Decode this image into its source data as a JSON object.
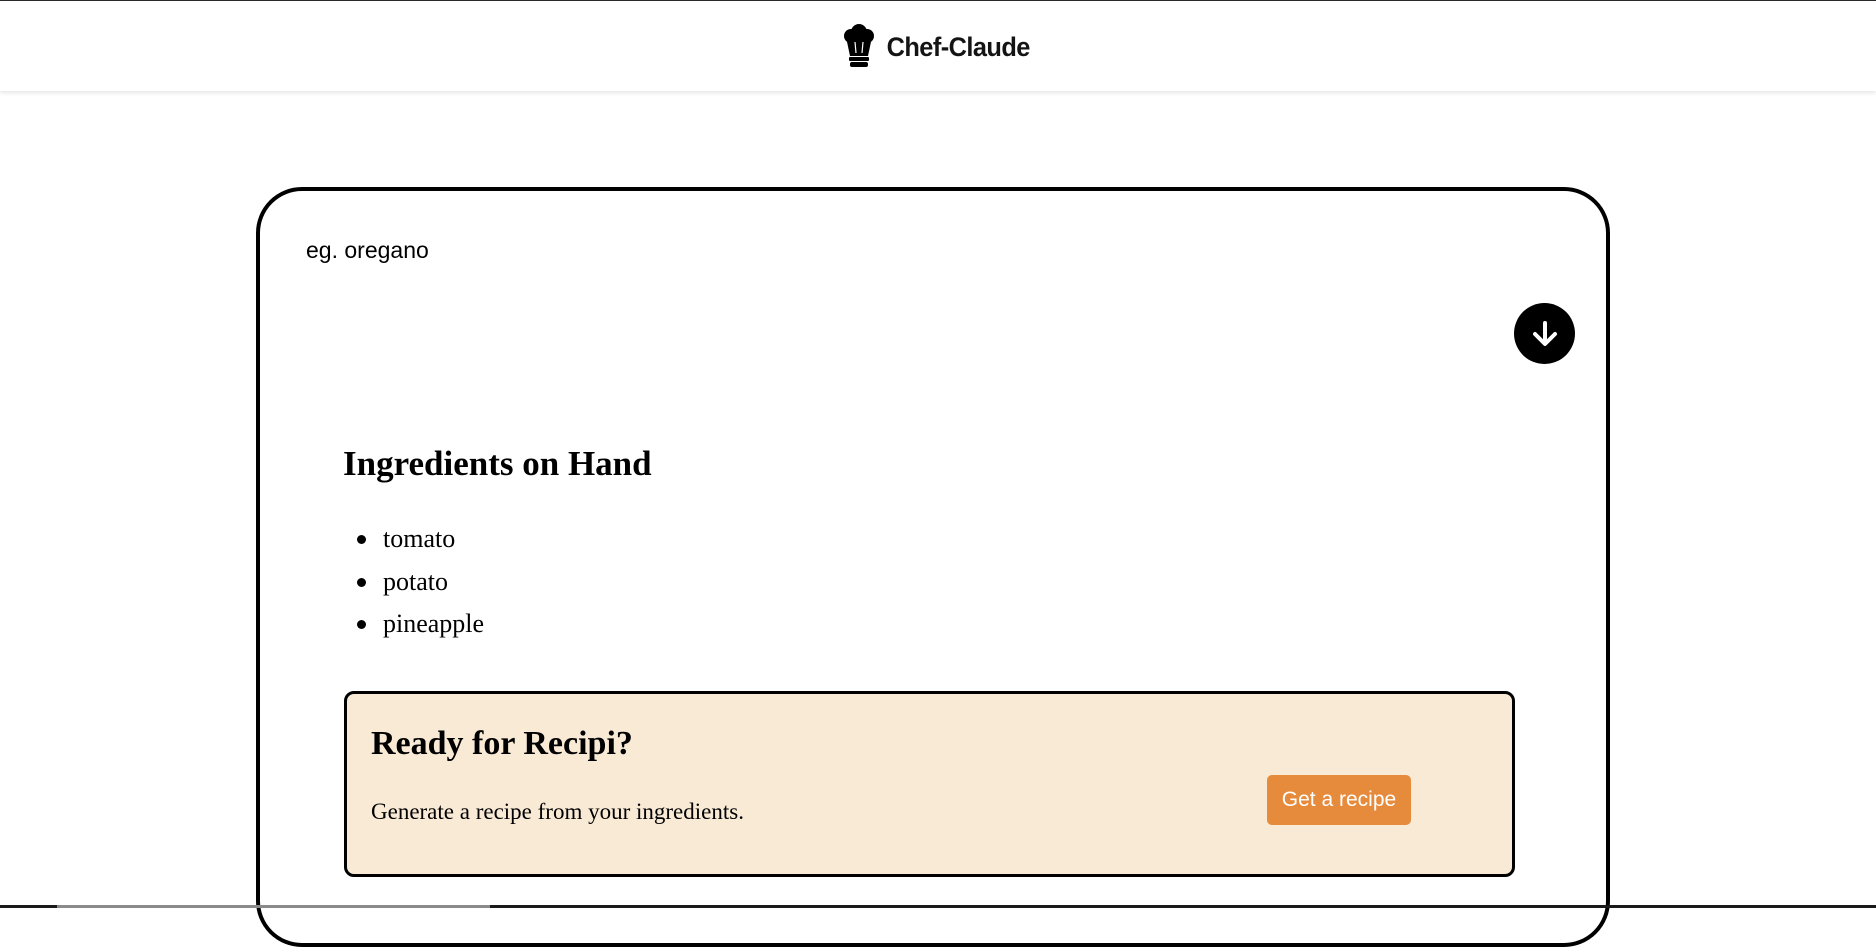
{
  "header": {
    "logo_icon": "chef-hat-icon",
    "logo_text": "Chef-Claude"
  },
  "form": {
    "placeholder": "eg. oregano",
    "add_button_icon": "arrow-down-circle-icon"
  },
  "ingredients": {
    "title": "Ingredients on Hand",
    "items": [
      "tomato",
      "potato",
      "pineapple"
    ]
  },
  "recipe_cta": {
    "title": "Ready for Recipi?",
    "description": "Generate a recipe from your ingredients.",
    "button_label": "Get a recipe"
  },
  "colors": {
    "accent": "#e68a3c",
    "cta_background": "#f9ead6",
    "border": "#000000"
  }
}
